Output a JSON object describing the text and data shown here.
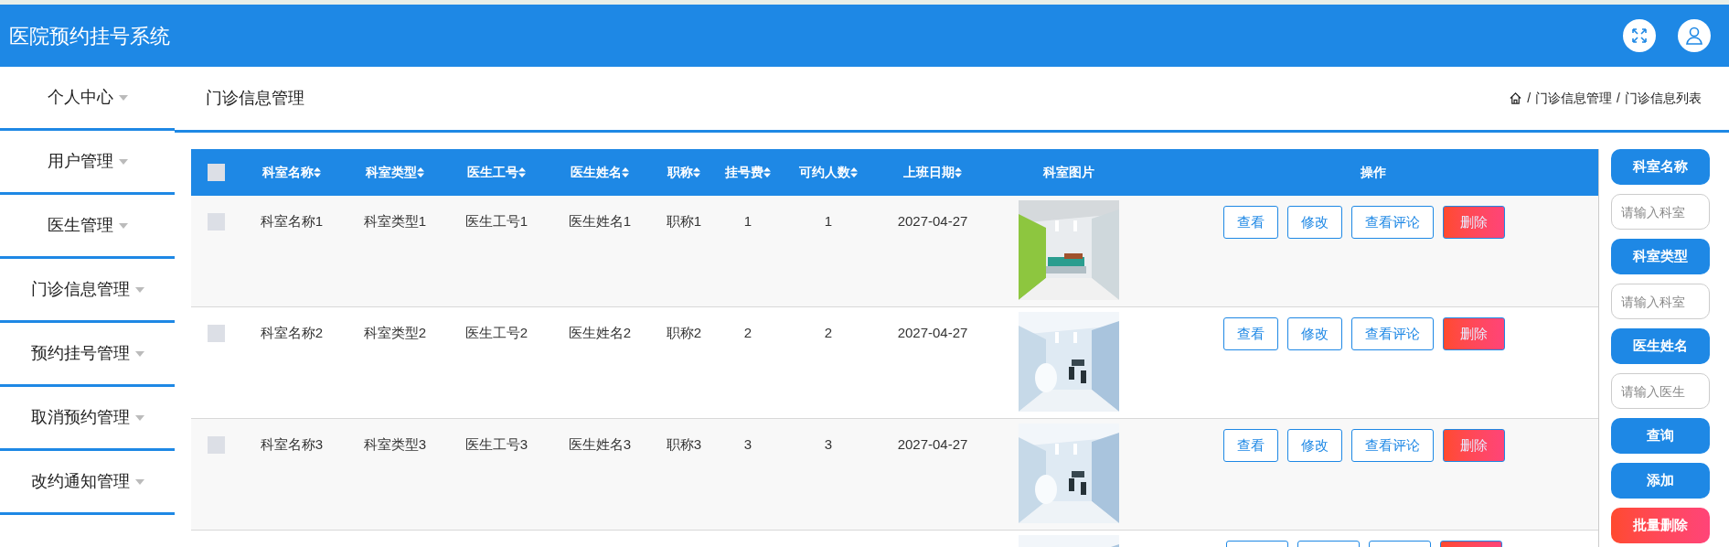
{
  "header": {
    "title": "医院预约挂号系统"
  },
  "sidebar": {
    "items": [
      {
        "label": "个人中心"
      },
      {
        "label": "用户管理"
      },
      {
        "label": "医生管理"
      },
      {
        "label": "门诊信息管理"
      },
      {
        "label": "预约挂号管理"
      },
      {
        "label": "取消预约管理"
      },
      {
        "label": "改约通知管理"
      }
    ]
  },
  "page": {
    "title": "门诊信息管理",
    "breadcrumb": [
      {
        "kind": "home"
      },
      {
        "kind": "sep",
        "text": "/"
      },
      {
        "kind": "link",
        "text": "门诊信息管理"
      },
      {
        "kind": "sep",
        "text": "/"
      },
      {
        "kind": "current",
        "text": "门诊信息列表"
      }
    ]
  },
  "table": {
    "select_all": {
      "checked": false
    },
    "columns": [
      {
        "label": "科室名称",
        "sortable": true
      },
      {
        "label": "科室类型",
        "sortable": true
      },
      {
        "label": "医生工号",
        "sortable": true
      },
      {
        "label": "医生姓名",
        "sortable": true
      },
      {
        "label": "职称",
        "sortable": true
      },
      {
        "label": "挂号费",
        "sortable": true
      },
      {
        "label": "可约人数",
        "sortable": true
      },
      {
        "label": "上班日期",
        "sortable": true
      },
      {
        "label": "科室图片",
        "sortable": false
      },
      {
        "label": "操作",
        "sortable": false
      }
    ],
    "rows": [
      {
        "kind": "full",
        "checked": false,
        "cells": [
          "科室名称1",
          "科室类型1",
          "医生工号1",
          "医生姓名1",
          "职称1",
          "1",
          "1",
          "2027-04-27"
        ],
        "actions": [
          {
            "kind": "outline",
            "label": "查看"
          },
          {
            "kind": "outline",
            "label": "修改"
          },
          {
            "kind": "outline",
            "label": "查看评论"
          },
          {
            "kind": "danger",
            "label": "删除"
          }
        ]
      },
      {
        "kind": "full",
        "checked": false,
        "cells": [
          "科室名称2",
          "科室类型2",
          "医生工号2",
          "医生姓名2",
          "职称2",
          "2",
          "2",
          "2027-04-27"
        ],
        "actions": [
          {
            "kind": "outline",
            "label": "查看"
          },
          {
            "kind": "outline",
            "label": "修改"
          },
          {
            "kind": "outline",
            "label": "查看评论"
          },
          {
            "kind": "danger",
            "label": "删除"
          }
        ]
      },
      {
        "kind": "full",
        "checked": false,
        "cells": [
          "科室名称3",
          "科室类型3",
          "医生工号3",
          "医生姓名3",
          "职称3",
          "3",
          "3",
          "2027-04-27"
        ],
        "actions": [
          {
            "kind": "outline",
            "label": "查看"
          },
          {
            "kind": "outline",
            "label": "修改"
          },
          {
            "kind": "outline",
            "label": "查看评论"
          },
          {
            "kind": "danger",
            "label": "删除"
          }
        ]
      },
      {
        "kind": "partial",
        "actions": [
          {
            "kind": "outline"
          },
          {
            "kind": "outline"
          },
          {
            "kind": "outline"
          },
          {
            "kind": "danger"
          }
        ]
      }
    ]
  },
  "search_panel": [
    {
      "kind": "label",
      "text": "科室名称"
    },
    {
      "kind": "input",
      "placeholder": "请输入科室"
    },
    {
      "kind": "label",
      "text": "科室类型"
    },
    {
      "kind": "input",
      "placeholder": "请输入科室"
    },
    {
      "kind": "label",
      "text": "医生姓名"
    },
    {
      "kind": "input",
      "placeholder": "请输入医生"
    },
    {
      "kind": "button",
      "text": "查询"
    },
    {
      "kind": "button",
      "text": "添加"
    },
    {
      "kind": "danger",
      "text": "批量删除"
    }
  ]
}
